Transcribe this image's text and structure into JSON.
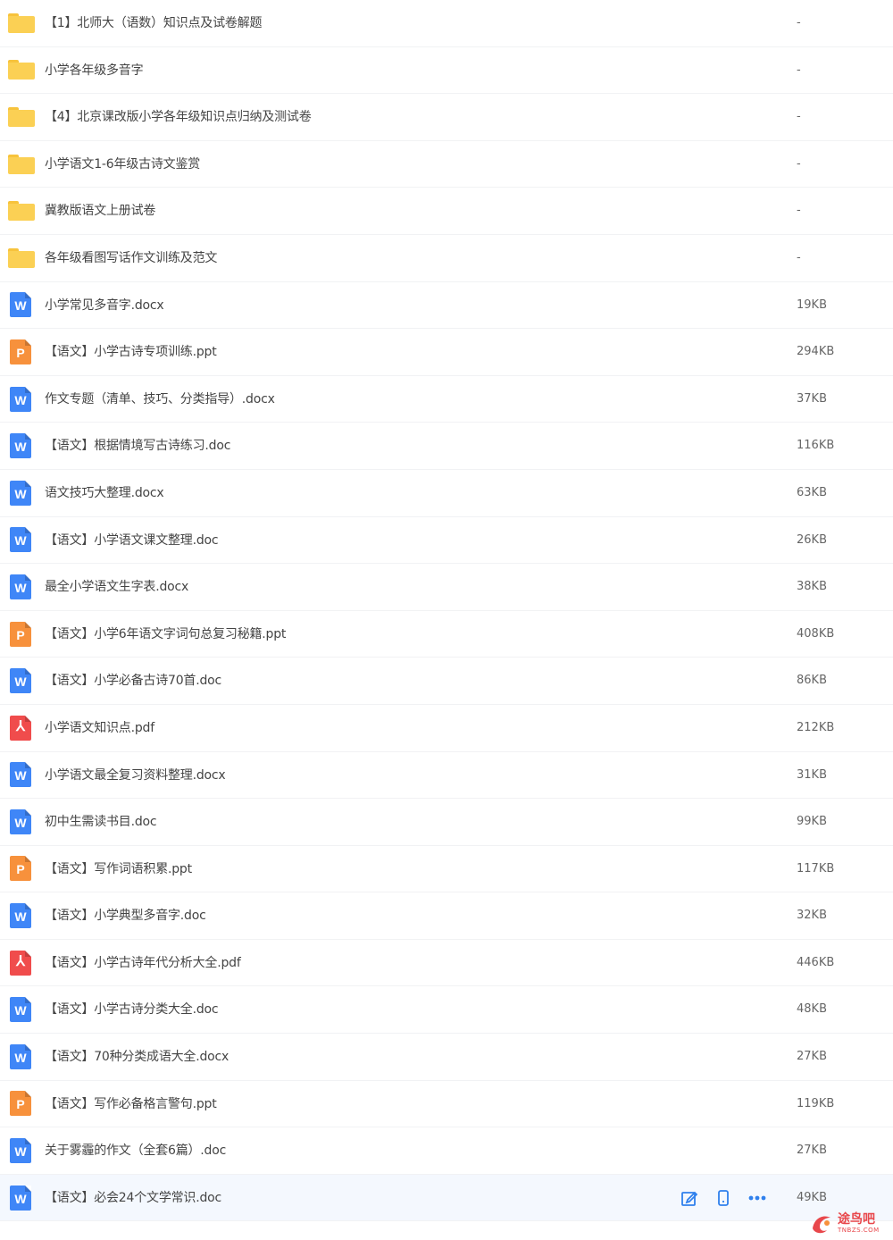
{
  "files": [
    {
      "name": "【1】北师大（语数）知识点及试卷解题",
      "size": "-",
      "type": "folder"
    },
    {
      "name": "小学各年级多音字",
      "size": "-",
      "type": "folder"
    },
    {
      "name": "【4】北京课改版小学各年级知识点归纳及测试卷",
      "size": "-",
      "type": "folder"
    },
    {
      "name": "小学语文1-6年级古诗文鉴赏",
      "size": "-",
      "type": "folder"
    },
    {
      "name": "冀教版语文上册试卷",
      "size": "-",
      "type": "folder"
    },
    {
      "name": "各年级看图写话作文训练及范文",
      "size": "-",
      "type": "folder"
    },
    {
      "name": "小学常见多音字.docx",
      "size": "19KB",
      "type": "word"
    },
    {
      "name": "【语文】小学古诗专项训练.ppt",
      "size": "294KB",
      "type": "ppt"
    },
    {
      "name": "作文专题（清单、技巧、分类指导）.docx",
      "size": "37KB",
      "type": "word"
    },
    {
      "name": "【语文】根据情境写古诗练习.doc",
      "size": "116KB",
      "type": "word"
    },
    {
      "name": "语文技巧大整理.docx",
      "size": "63KB",
      "type": "word"
    },
    {
      "name": "【语文】小学语文课文整理.doc",
      "size": "26KB",
      "type": "word"
    },
    {
      "name": "最全小学语文生字表.docx",
      "size": "38KB",
      "type": "word"
    },
    {
      "name": "【语文】小学6年语文字词句总复习秘籍.ppt",
      "size": "408KB",
      "type": "ppt"
    },
    {
      "name": "【语文】小学必备古诗70首.doc",
      "size": "86KB",
      "type": "word"
    },
    {
      "name": "小学语文知识点.pdf",
      "size": "212KB",
      "type": "pdf"
    },
    {
      "name": "小学语文最全复习资料整理.docx",
      "size": "31KB",
      "type": "word"
    },
    {
      "name": "初中生需读书目.doc",
      "size": "99KB",
      "type": "word"
    },
    {
      "name": "【语文】写作词语积累.ppt",
      "size": "117KB",
      "type": "ppt"
    },
    {
      "name": "【语文】小学典型多音字.doc",
      "size": "32KB",
      "type": "word"
    },
    {
      "name": "【语文】小学古诗年代分析大全.pdf",
      "size": "446KB",
      "type": "pdf"
    },
    {
      "name": "【语文】小学古诗分类大全.doc",
      "size": "48KB",
      "type": "word"
    },
    {
      "name": "【语文】70种分类成语大全.docx",
      "size": "27KB",
      "type": "word"
    },
    {
      "name": "【语文】写作必备格言警句.ppt",
      "size": "119KB",
      "type": "ppt"
    },
    {
      "name": "关于雾霾的作文（全套6篇）.doc",
      "size": "27KB",
      "type": "word"
    },
    {
      "name": "【语文】必会24个文学常识.doc",
      "size": "49KB",
      "type": "word",
      "hovered": true
    }
  ],
  "icon_glyphs": {
    "word": "W",
    "ppt": "P",
    "pdf": "⅄"
  },
  "row_actions": [
    "edit-icon",
    "phone-icon",
    "more-icon"
  ],
  "watermark": {
    "title": "途鸟吧",
    "subtitle": "TNBZS.COM"
  },
  "colors": {
    "folder": "#fbd054",
    "word": "#3f86f7",
    "ppt": "#f7913c",
    "pdf": "#f04c4c",
    "action": "#2f80ed",
    "hover_bg": "#f4f8fe"
  }
}
